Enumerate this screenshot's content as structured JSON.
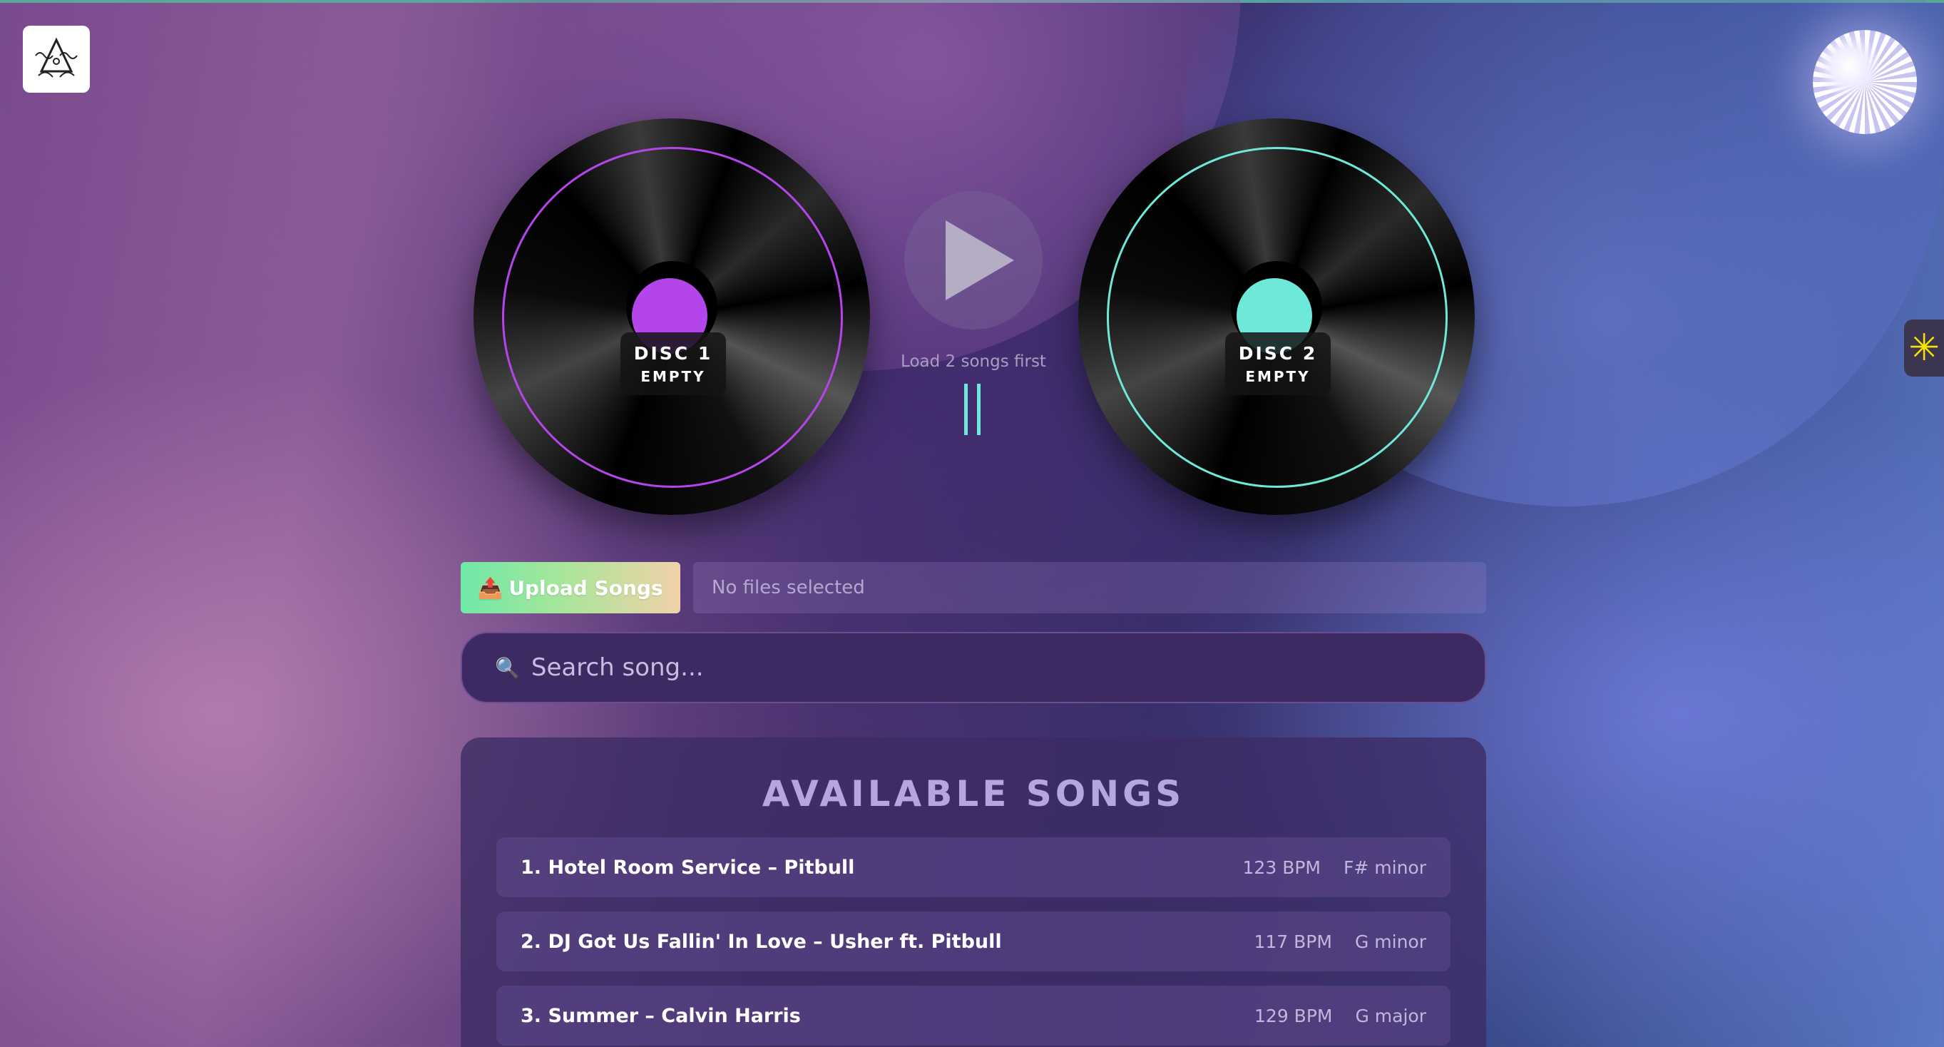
{
  "decks": [
    {
      "title": "DISC 1",
      "status": "EMPTY",
      "accent": "#b445ea"
    },
    {
      "title": "DISC 2",
      "status": "EMPTY",
      "accent": "#6ee8d8"
    }
  ],
  "player": {
    "hint": "Load 2 songs first",
    "play_icon": "play-icon"
  },
  "upload": {
    "label": "Upload Songs",
    "icon": "📤",
    "file_status": "No files selected"
  },
  "search": {
    "placeholder": "Search song...",
    "icon": "🔍"
  },
  "songs": {
    "title": "AVAILABLE SONGS",
    "items": [
      {
        "name": "1. Hotel Room Service – Pitbull",
        "bpm": "123 BPM",
        "key": "F# minor"
      },
      {
        "name": "2. DJ Got Us Fallin' In Love – Usher ft. Pitbull",
        "bpm": "117 BPM",
        "key": "G minor"
      },
      {
        "name": "3. Summer – Calvin Harris",
        "bpm": "129 BPM",
        "key": "G major"
      }
    ]
  },
  "colors": {
    "accent_purple": "#b445ea",
    "accent_teal": "#6ee8d8",
    "side_tab_icon": "#f5e400"
  }
}
